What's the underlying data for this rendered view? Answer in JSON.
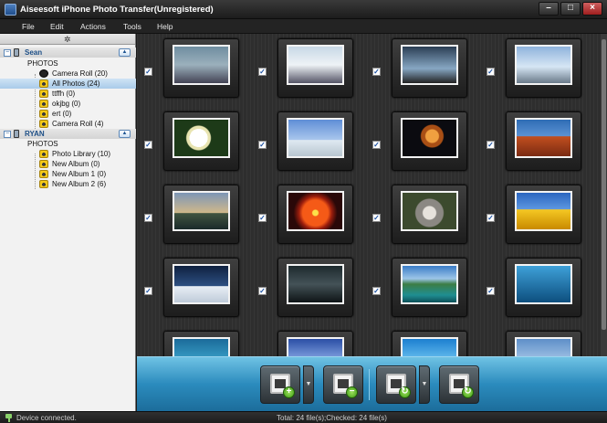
{
  "window": {
    "title": "Aiseesoft iPhone Photo Transfer(Unregistered)"
  },
  "menu": {
    "items": [
      "File",
      "Edit",
      "Actions",
      "Tools",
      "Help"
    ]
  },
  "sidebar": {
    "devices": [
      {
        "name": "Sean",
        "section": "PHOTOS",
        "albums": [
          {
            "label": "Camera Roll (20)",
            "icon": "camera-icon",
            "selected": false
          },
          {
            "label": "All Photos (24)",
            "icon": "folder-icon",
            "selected": true
          },
          {
            "label": "ttffh (0)",
            "icon": "folder-icon",
            "selected": false
          },
          {
            "label": "okjbg (0)",
            "icon": "folder-icon",
            "selected": false
          },
          {
            "label": "ert (0)",
            "icon": "folder-icon",
            "selected": false
          },
          {
            "label": "Camera Roll (4)",
            "icon": "folder-icon",
            "selected": false
          }
        ]
      },
      {
        "name": "RYAN",
        "section": "PHOTOS",
        "albums": [
          {
            "label": "Photo Library (10)",
            "icon": "folder-icon",
            "selected": false
          },
          {
            "label": "New Album (0)",
            "icon": "folder-icon",
            "selected": false
          },
          {
            "label": "New Album 1 (0)",
            "icon": "folder-icon",
            "selected": false
          },
          {
            "label": "New Album 2 (6)",
            "icon": "folder-icon",
            "selected": false
          }
        ]
      }
    ]
  },
  "photos": [
    {
      "thumb": "t-vase",
      "checked": true
    },
    {
      "thumb": "t-vase2",
      "checked": true
    },
    {
      "thumb": "t-vase3",
      "checked": true
    },
    {
      "thumb": "t-vase4",
      "checked": true
    },
    {
      "thumb": "t-flower",
      "checked": true
    },
    {
      "thumb": "t-penguins",
      "checked": true
    },
    {
      "thumb": "t-jelly",
      "checked": true
    },
    {
      "thumb": "t-desert",
      "checked": true
    },
    {
      "thumb": "t-lighthouse",
      "checked": true
    },
    {
      "thumb": "t-chrys",
      "checked": true
    },
    {
      "thumb": "t-koala",
      "checked": true
    },
    {
      "thumb": "t-tulips",
      "checked": true
    },
    {
      "thumb": "t-winter",
      "checked": true
    },
    {
      "thumb": "t-dark",
      "checked": true
    },
    {
      "thumb": "t-lake",
      "checked": true
    },
    {
      "thumb": "t-palm",
      "checked": true
    },
    {
      "thumb": "t-aerial",
      "checked": false
    },
    {
      "thumb": "t-fuji",
      "checked": false
    },
    {
      "thumb": "t-drops",
      "checked": false
    },
    {
      "thumb": "t-blue",
      "checked": false
    }
  ],
  "toolbar": {
    "buttons": [
      {
        "name": "add-photos-button",
        "icon": "film-add-icon",
        "dropdown": true
      },
      {
        "name": "remove-photos-button",
        "icon": "film-remove-icon",
        "dropdown": false
      },
      {
        "name": "export-photos-button",
        "icon": "export-icon",
        "dropdown": true
      },
      {
        "name": "export-to-pc-button",
        "icon": "monitor-icon",
        "dropdown": false
      }
    ]
  },
  "status": {
    "connection": "Device connected.",
    "summary": "Total: 24 file(s);Checked: 24 file(s)"
  }
}
